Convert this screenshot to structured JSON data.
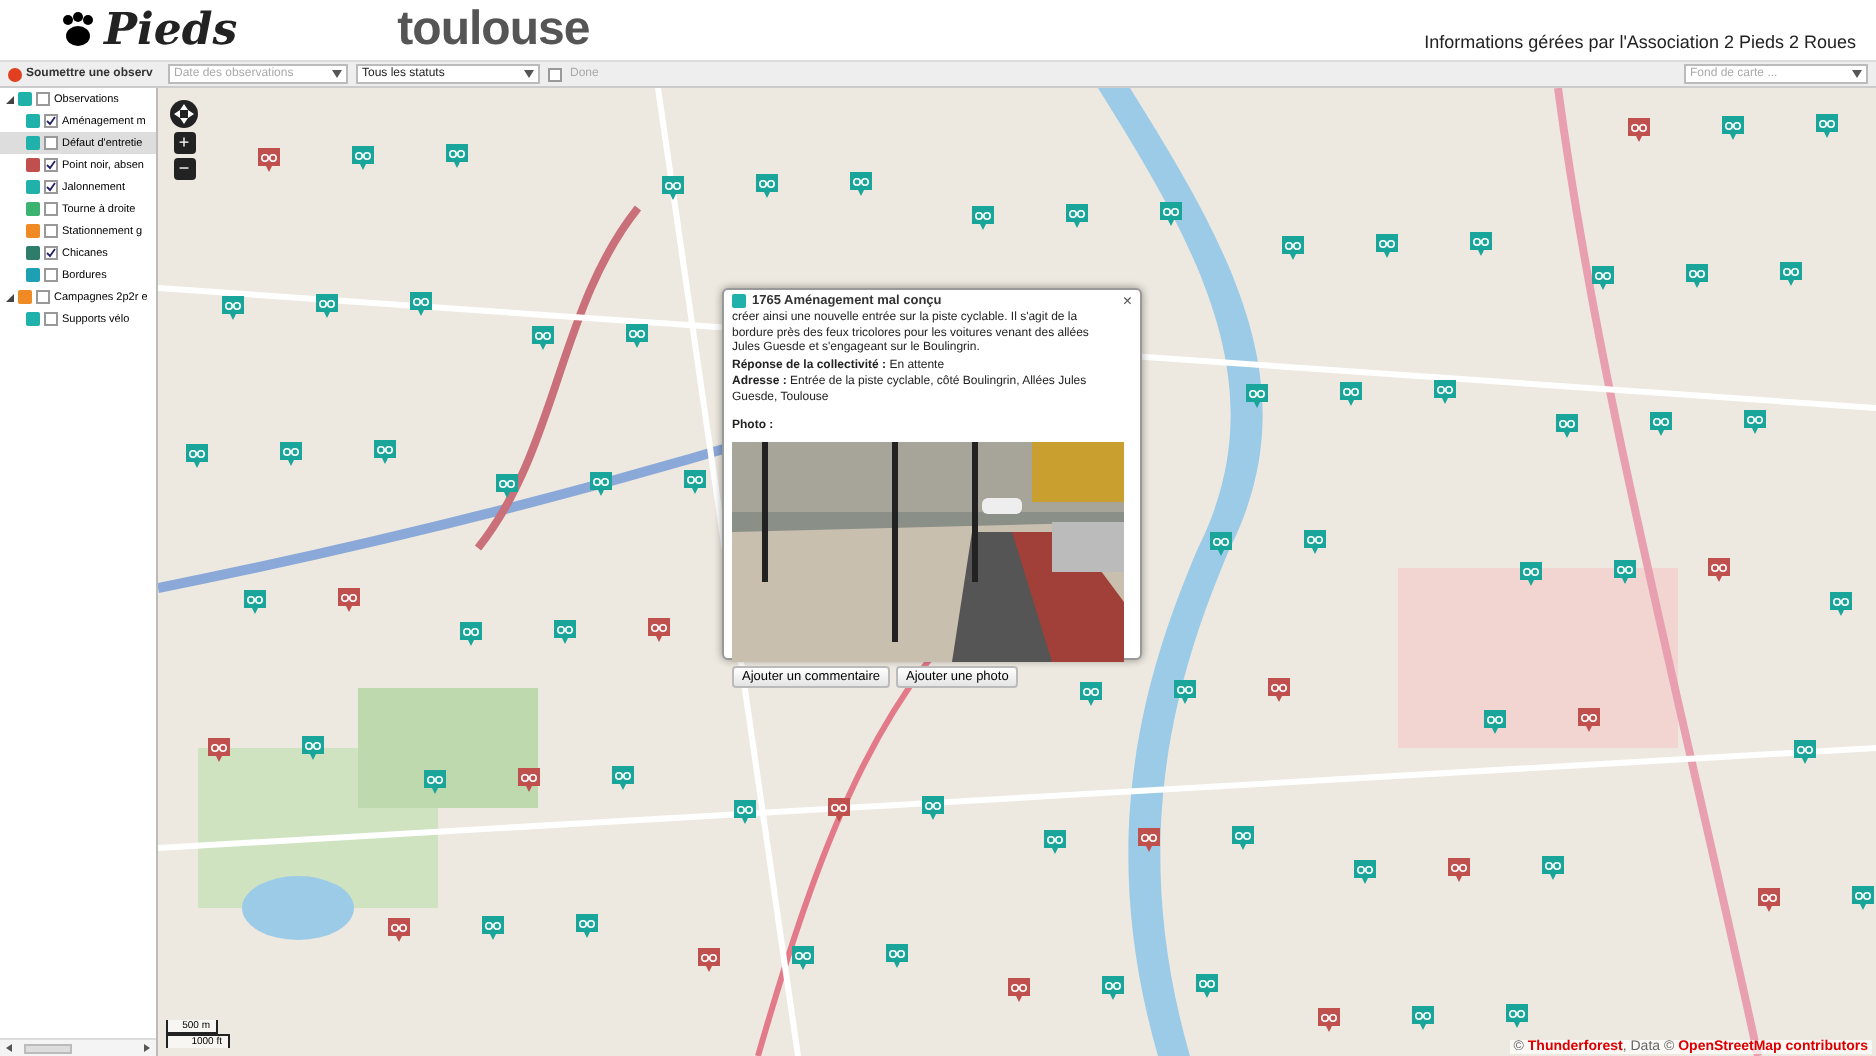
{
  "header": {
    "logo_left": "Pieds",
    "logo_right": "toulouse",
    "credit": "Informations gérées par l'Association 2 Pieds 2 Roues"
  },
  "toolbar": {
    "submit": "Soumettre une observ",
    "date_filter": {
      "placeholder": "Date des observations"
    },
    "status_filter": {
      "value": "Tous les statuts"
    },
    "done": {
      "label": "Done",
      "checked": false
    },
    "basemap": {
      "placeholder": "Fond de carte ..."
    }
  },
  "layers": [
    {
      "label": "Observations",
      "checked": false,
      "selected": false,
      "color": "#20b2aa",
      "expanded": true,
      "children": [
        {
          "label": "Aménagement m",
          "checked": true,
          "selected": false,
          "color": "#20b2aa"
        },
        {
          "label": "Défaut d'entretie",
          "checked": false,
          "selected": true,
          "color": "#20b2aa"
        },
        {
          "label": "Point noir, absen",
          "checked": true,
          "selected": false,
          "color": "#c0504d"
        },
        {
          "label": "Jalonnement",
          "checked": true,
          "selected": false,
          "color": "#20b2aa"
        },
        {
          "label": "Tourne à droite",
          "checked": false,
          "selected": false,
          "color": "#3cb371"
        },
        {
          "label": "Stationnement g",
          "checked": false,
          "selected": false,
          "color": "#f08a24"
        },
        {
          "label": "Chicanes",
          "checked": true,
          "selected": false,
          "color": "#2e7d6b"
        },
        {
          "label": "Bordures",
          "checked": false,
          "selected": false,
          "color": "#1ea0b4"
        }
      ]
    },
    {
      "label": "Campagnes 2p2r e",
      "checked": false,
      "selected": false,
      "color": "#f08a24",
      "expanded": true,
      "children": [
        {
          "label": "Supports vélo",
          "checked": false,
          "selected": false,
          "color": "#20b2aa"
        }
      ]
    }
  ],
  "map": {
    "zoom_in": "+",
    "zoom_out": "−",
    "scale": [
      "500 m",
      "1000 ft"
    ],
    "attribution": {
      "prefix": "©",
      "provider": "Thunderforest",
      "data": ", Data ©",
      "osm": "OpenStreetMap contributors"
    }
  },
  "popup": {
    "title": "1765 Aménagement mal conçu",
    "close": "×",
    "description": "créer ainsi une nouvelle entrée sur la piste cyclable. Il s'agit de la bordure près des feux tricolores pour les voitures venant des allées Jules Guesde et s'engageant sur le Boulingrin.",
    "response": "**Réponse de la collectivité :** En attente",
    "address": "**Adresse :** Entrée de la piste cyclable, côté Boulingrin, Allées Jules Guesde, Toulouse",
    "photo_label": "Photo :",
    "buttons": [
      "Ajouter un commentaire",
      "Ajouter une photo"
    ]
  }
}
